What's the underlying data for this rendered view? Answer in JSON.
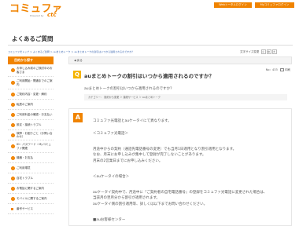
{
  "header": {
    "logo_text": "コミュファ",
    "logo_sub": "Powered by",
    "logo_brand": "ctc",
    "web_login_label": "Webトータルログイン",
    "my_login_label": "Myコミュファログイン"
  },
  "page": {
    "title": "よくあるご質問"
  },
  "breadcrumb": "コミュファ光トップ ＞ よくあるご質問 ＞ auまとめトーク ＞ auまとめトークの割引はいつから適用されるのですか？",
  "search_tools": {
    "label": "文字サイズ変更",
    "small": "小",
    "medium": "中",
    "large": "大"
  },
  "sidebar": {
    "heading": "目的から探す",
    "items": [
      {
        "label": "お申し込み前のご検討中のお客さま",
        "tall": true,
        "marker": "dot"
      },
      {
        "label": "ご利用開始・開通までのご案内",
        "tall": true,
        "marker": "dot"
      },
      {
        "label": "ご契約内容・変更・解約",
        "tall": false,
        "marker": "dot"
      },
      {
        "label": "転居のご案内",
        "tall": false,
        "marker": "dot"
      },
      {
        "label": "ご利用料金の確認・お支払い",
        "tall": false,
        "marker": "dot"
      },
      {
        "label": "設定・接続トラブル",
        "tall": false,
        "marker": "dot"
      },
      {
        "label": "故障・お困りごと（お問い合わせ）",
        "tall": false,
        "marker": "dot"
      },
      {
        "label": "ID・パスワード・Myコミュファ関連",
        "tall": true,
        "marker": "dot"
      },
      {
        "label": "機器・お支払",
        "tall": false,
        "marker": "dot"
      },
      {
        "label": "ご利用環境",
        "tall": false,
        "marker": "dot"
      },
      {
        "label": "自宅トラブル",
        "tall": false,
        "marker": "dot"
      },
      {
        "label": "お電話に関するご案内",
        "tall": false,
        "marker": "dot"
      },
      {
        "label": "モバイルに関するご案内",
        "tall": false,
        "marker": "dot"
      },
      {
        "label": "番号サービス",
        "tall": false,
        "marker": "square"
      }
    ]
  },
  "main": {
    "back_label": "◀ 戻る",
    "faq_no": "No：433",
    "print_label": "印刷",
    "question_badge": "Q",
    "question_title": "auまとめトークの割引はいつから適用されるのですか？",
    "question_body": "auまとめトークの割引はいつから適用されるのですか？",
    "category": "カテゴリー： 契約から変更 ＞ 接続サービス ＞ auまとめトーク",
    "answer_badge": "A",
    "answer_lines": [
      "コミュファ光電話とauケータイにて異なります。",
      "",
      "＜コミュファ光電話＞",
      "",
      "月途中からの契約（通話先電話番号の変更）でも当月1日適用となり割引適用となります。",
      "なお、月末にお申し込みが集中して登録が完了しないことがあります。",
      "月末の2営業日までにお申し込みください。",
      "",
      "＜auケータイの場合＞",
      "",
      "auケータイ契約中で、月途中に『ご契約者の自宅電話番号』の登録をコミュファ光電話に変更された場合は、",
      "当該月の翌月分から割引が適用されます。",
      "auケータイ側の割引適用等、詳しくは以下までお問い合わせください。",
      "",
      "■auお客様センター"
    ]
  }
}
